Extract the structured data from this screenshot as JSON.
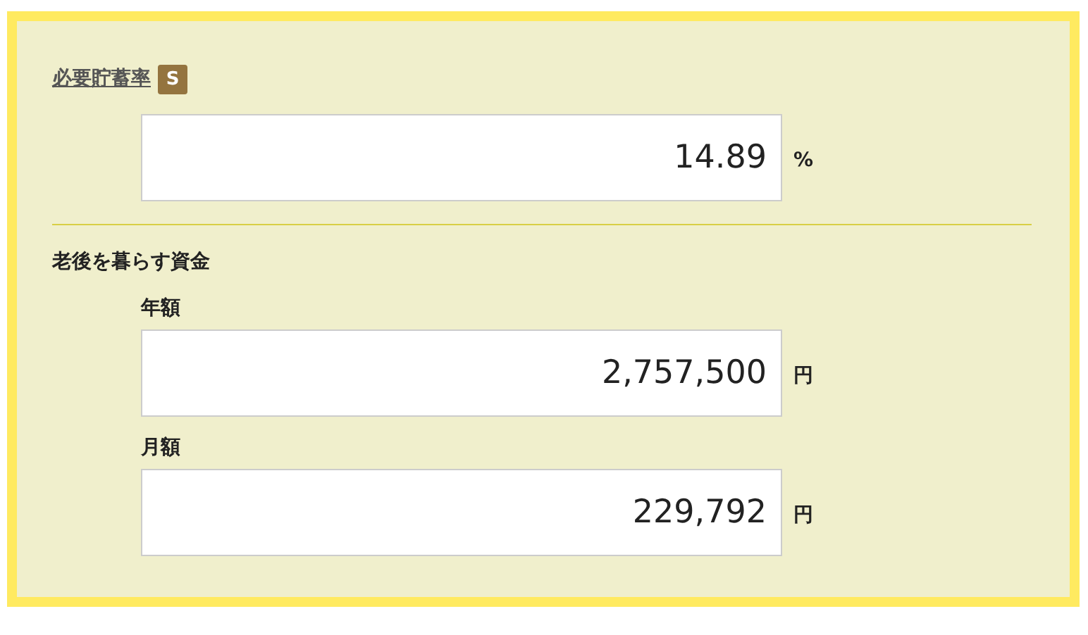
{
  "savings_rate": {
    "label": "必要貯蓄率",
    "badge": "S",
    "value": "14.89",
    "unit": "%"
  },
  "retirement_funds": {
    "title": "老後を暮らす資金",
    "fields": [
      {
        "label": "年額",
        "value": "2,757,500",
        "unit": "円"
      },
      {
        "label": "月額",
        "value": "229,792",
        "unit": "円"
      }
    ]
  }
}
